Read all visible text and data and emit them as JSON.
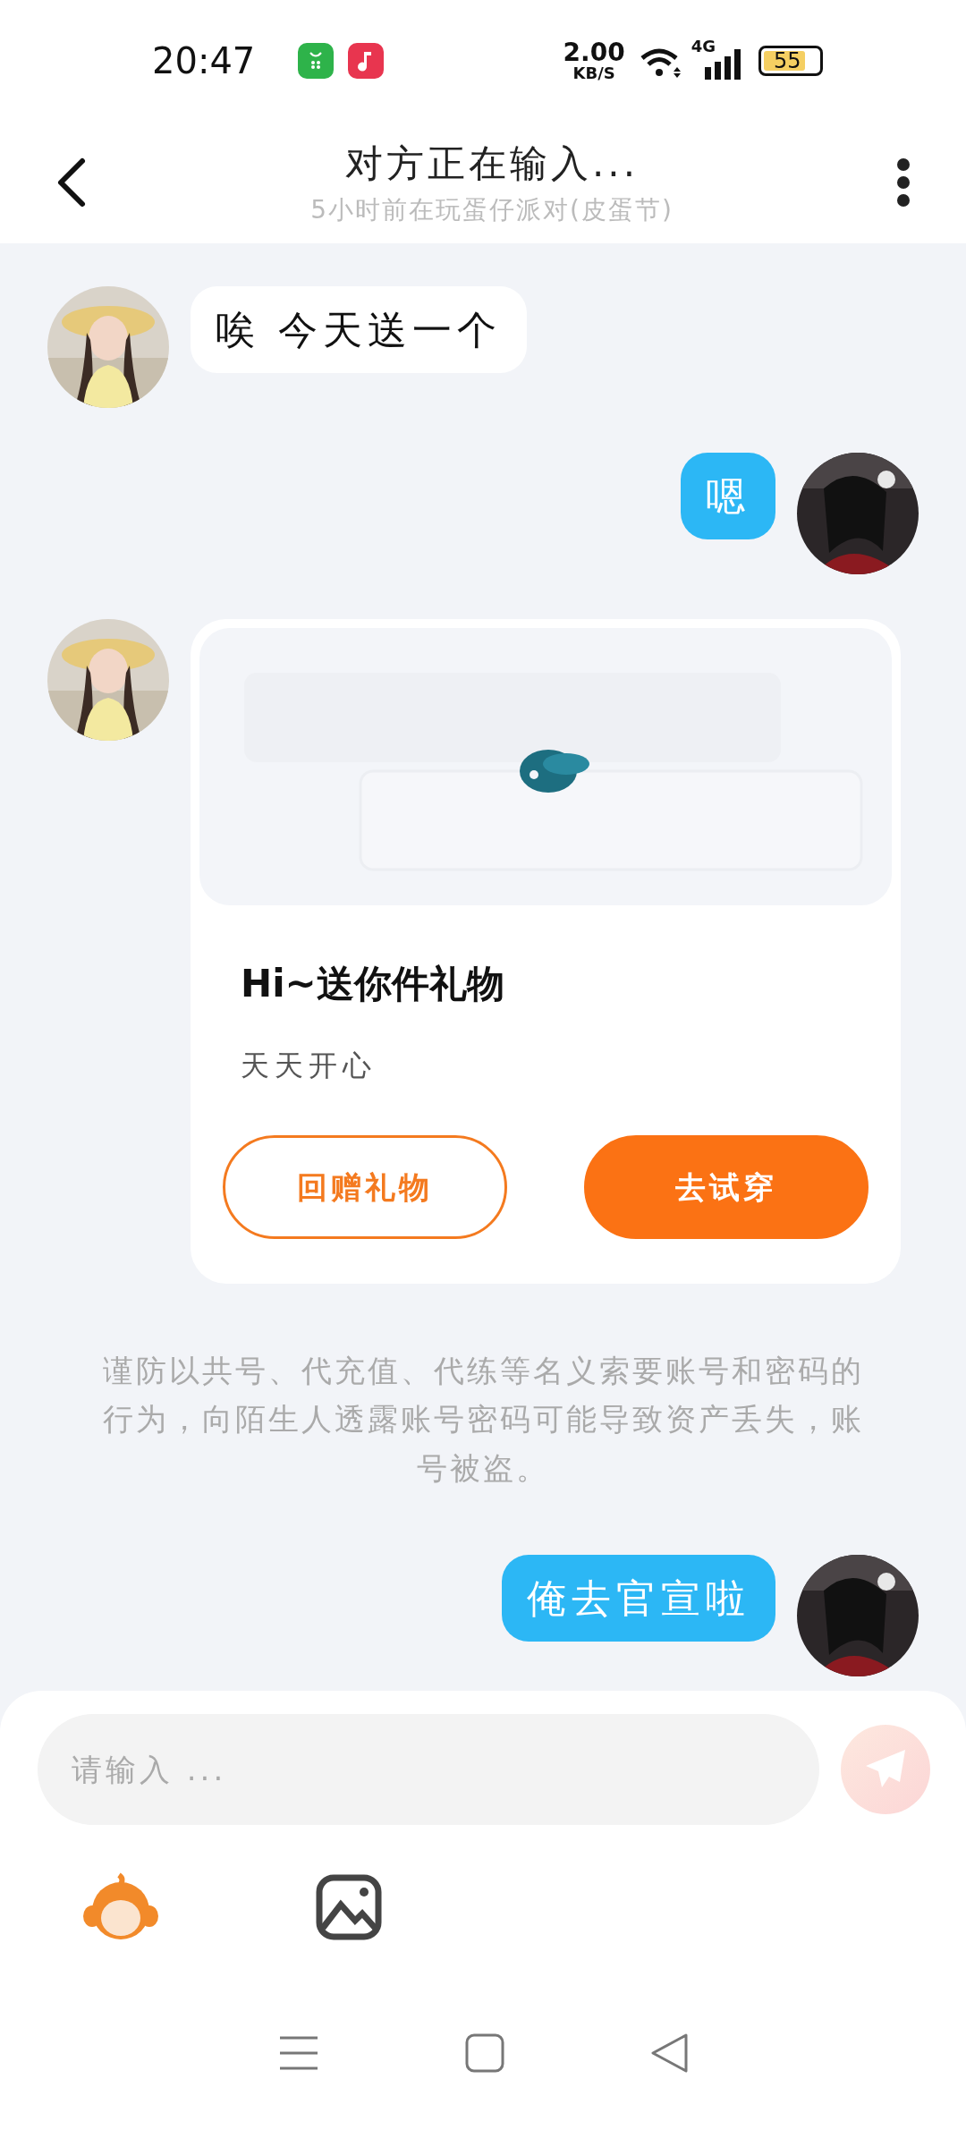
{
  "status_bar": {
    "time": "20:47",
    "speed": "2.00",
    "speed_unit": "KB/S",
    "network": "4G",
    "battery": "55"
  },
  "header": {
    "title": "对方正在输入...",
    "subtitle": "5小时前在玩蛋仔派对(皮蛋节)"
  },
  "messages": [
    {
      "kind": "text",
      "from_me": false,
      "text": "唉 今天送一个"
    },
    {
      "kind": "text",
      "from_me": true,
      "text": "嗯"
    },
    {
      "kind": "gift",
      "from_me": false,
      "title": "Hi~送你件礼物",
      "subtitle": "天天开心",
      "buttons": [
        {
          "label": "回赠礼物",
          "primary": false
        },
        {
          "label": "去试穿",
          "primary": true
        }
      ]
    },
    {
      "kind": "notice",
      "text": "谨防以共号、代充值、代练等名义索要账号和密码的行为，向陌生人透露账号密码可能导致资产丢失，账号被盗。"
    },
    {
      "kind": "text",
      "from_me": true,
      "text": "俺去官宣啦"
    }
  ],
  "composer": {
    "placeholder": "请输入 ..."
  }
}
